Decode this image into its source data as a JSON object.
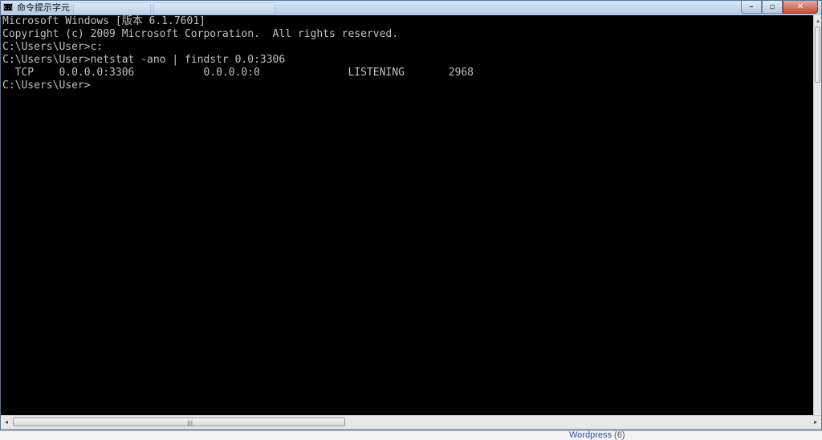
{
  "window": {
    "title": "命令提示字元",
    "icon": "cmd-icon",
    "controls": {
      "minimize_glyph": "–",
      "maximize_glyph": "▫",
      "close_glyph": "✕"
    }
  },
  "console": {
    "lines": [
      "Microsoft Windows [版本 6.1.7601]",
      "Copyright (c) 2009 Microsoft Corporation.  All rights reserved.",
      "",
      "C:\\Users\\User>c:",
      "",
      "C:\\Users\\User>netstat -ano | findstr 0.0:3306",
      "  TCP    0.0.0.0:3306           0.0.0.0:0              LISTENING       2968",
      "",
      "C:\\Users\\User>"
    ],
    "text_color": "#c0c0c0",
    "background_color": "#000000"
  },
  "scrollbars": {
    "left_arrow": "◂",
    "right_arrow": "▸",
    "up_arrow": "▴",
    "grip": "|||"
  },
  "background": {
    "link_text": "Wordpress",
    "link_count": "(6)",
    "link_color": "#1a55b8"
  }
}
